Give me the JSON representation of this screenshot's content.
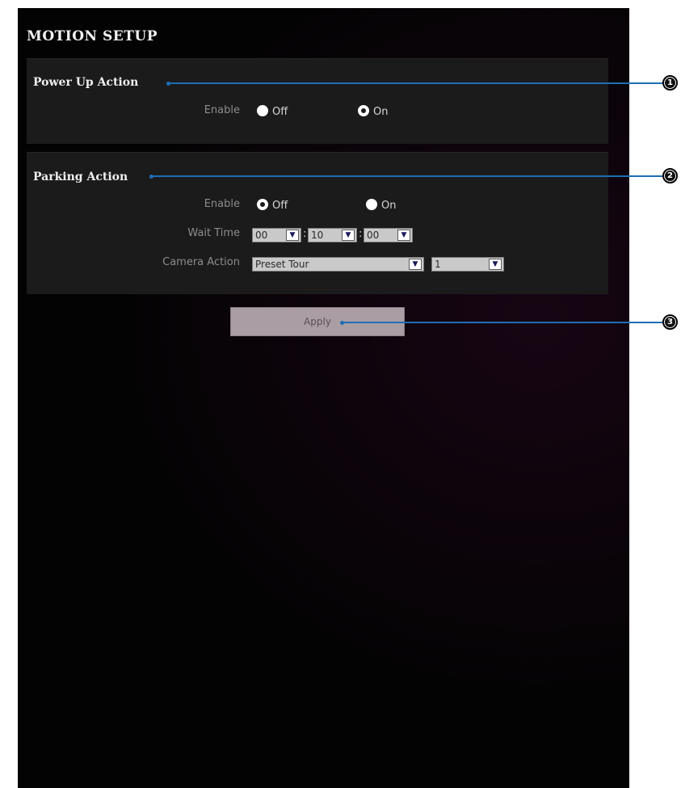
{
  "page": {
    "title": "MOTION SETUP"
  },
  "power_up": {
    "section_title": "Power Up Action",
    "enable_label": "Enable",
    "options": [
      {
        "label": "Off",
        "selected": false
      },
      {
        "label": "On",
        "selected": true
      }
    ]
  },
  "parking": {
    "section_title": "Parking Action",
    "enable_label": "Enable",
    "options": [
      {
        "label": "Off",
        "selected": true
      },
      {
        "label": "On",
        "selected": false
      }
    ],
    "wait_time_label": "Wait Time",
    "wait_time": {
      "hours": "00",
      "minutes": "10",
      "seconds": "00",
      "separator": ":"
    },
    "camera_action_label": "Camera Action",
    "camera_action_value": "Preset Tour",
    "camera_action_number": "1"
  },
  "apply_label": "Apply",
  "callouts": [
    "1",
    "2",
    "3"
  ],
  "colors": {
    "callout_line": "#1d6fb4",
    "background": "#030303",
    "panel": "#1b1b1b",
    "apply_button": "#aa9ea4"
  }
}
